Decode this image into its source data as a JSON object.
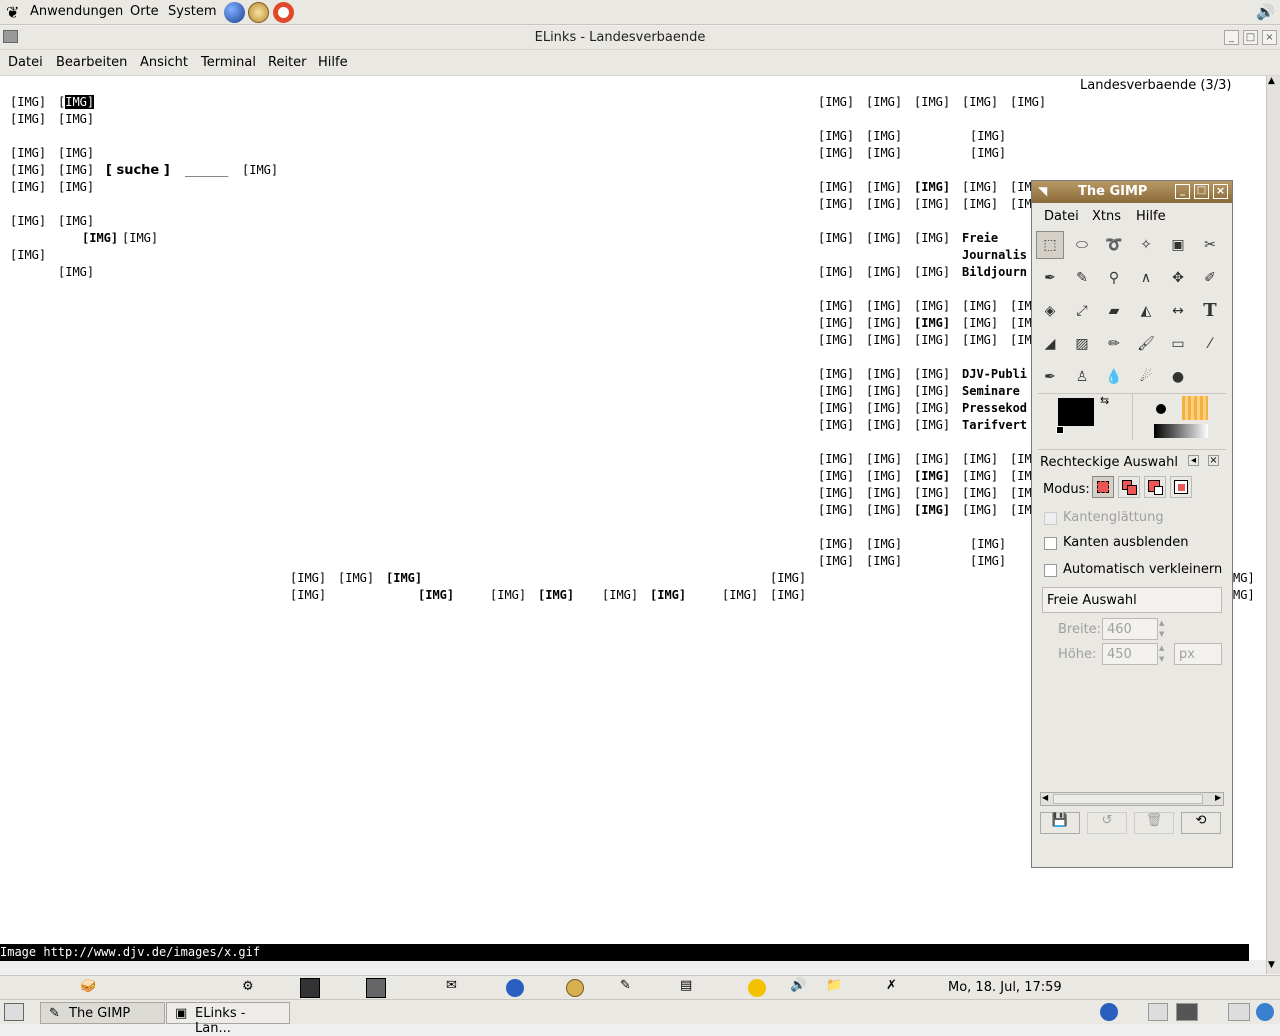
{
  "top_panel": {
    "menus": [
      "Anwendungen",
      "Orte",
      "System"
    ]
  },
  "window": {
    "title": "ELinks - Landesverbaende",
    "menu": [
      "Datei",
      "Bearbeiten",
      "Ansicht",
      "Terminal",
      "Reiter",
      "Hilfe"
    ]
  },
  "page": {
    "header": "Landesverbaende (3/3)",
    "img": "[IMG]",
    "search_button": "[ suche ]",
    "search_field": "______",
    "right_texts": {
      "freie": "Freie",
      "journalis": "Journalis",
      "bildjourn": "Bildjourn",
      "djv_publi": "DJV-Publi",
      "seminare": "Seminare",
      "pressekod": "Pressekod",
      "tarifvert": "Tarifvert",
      "img_partial": "[IM",
      "mg_partial": "MG]"
    },
    "status_line": "Image http://www.djv.de/images/x.gif"
  },
  "gimp": {
    "title": "The GIMP",
    "menu": [
      "Datei",
      "Xtns",
      "Hilfe"
    ],
    "tool_options_title": "Rechteckige Auswahl",
    "modus_label": "Modus:",
    "antialias": "Kantenglättung",
    "feather": "Kanten ausblenden",
    "auto_shrink": "Automatisch verkleinern",
    "freie_auswahl": "Freie Auswahl",
    "breite_label": "Breite:",
    "breite_value": "460",
    "hoehe_label": "Höhe:",
    "hoehe_value": "450",
    "unit": "px"
  },
  "bottom_panel": {
    "clock": "Mo, 18. Jul, 17:59",
    "tasks": [
      "The GIMP",
      "ELinks - Lan..."
    ]
  }
}
